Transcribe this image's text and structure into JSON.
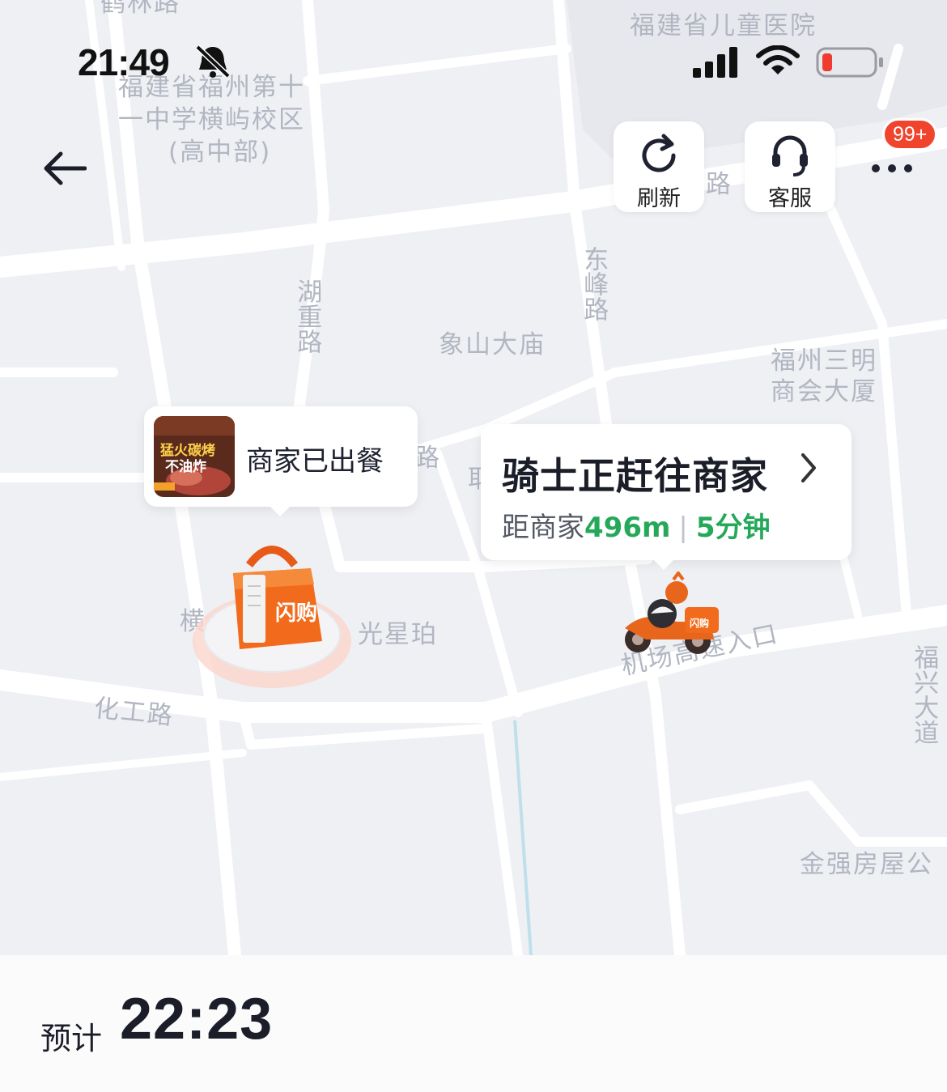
{
  "status_bar": {
    "time": "21:49"
  },
  "top_actions": {
    "refresh_label": "刷新",
    "service_label": "客服",
    "badge": "99+"
  },
  "map_labels": {
    "helin_road": "鹤林路",
    "childrens_hospital": "福建省儿童医院",
    "school_line1": "福建省福州第十",
    "school_line2": "一中学横屿校区",
    "school_line3": "(高中部)",
    "huli_road": "湖重路",
    "dongfeng_road": "东峰路",
    "xiangshan_temple": "象山大庙",
    "sanming_line1": "福州三明",
    "sanming_line2": "商会大厦",
    "road_fragment_top": "路",
    "road_fragment_mid": "路",
    "fragment_heng": "横",
    "fragment_guangxingpo": "光星珀",
    "fragment_ju": "耶",
    "huagong_road": "化工路",
    "airport_entrance": "机场高速入口",
    "fuxing_avenue": "福兴大道",
    "jinqiang": "金强房屋公"
  },
  "merchant_bubble": {
    "status": "商家已出餐",
    "thumb_text1": "猛火碳烤",
    "thumb_text2": "不油炸"
  },
  "rider_bubble": {
    "title": "骑士正赶往商家",
    "distance_prefix": "距商家",
    "distance": "496m",
    "separator": "|",
    "time": "5分钟"
  },
  "bag_logo": "闪购",
  "rider_box_logo": "闪购",
  "bottom": {
    "eta_label": "预计",
    "eta_time": "22:23"
  },
  "colors": {
    "accent_green": "#25a85a",
    "brand_orange": "#f26a1b",
    "badge_red": "#f0442d"
  }
}
